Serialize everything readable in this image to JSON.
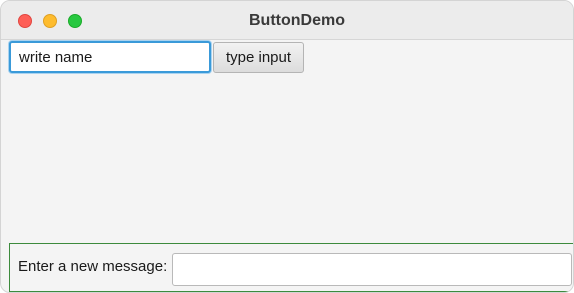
{
  "window": {
    "title": "ButtonDemo",
    "controls": {
      "close_color": "#fe5f57",
      "minimize_color": "#febc2e",
      "maximize_color": "#28c840"
    }
  },
  "top_row": {
    "name_input_value": "write name",
    "type_button_label": "type input",
    "focus_color": "#3a9ad9"
  },
  "bottom_panel": {
    "message_label": "Enter a new message:",
    "message_input_value": "",
    "border_color": "#3c8a3c"
  }
}
